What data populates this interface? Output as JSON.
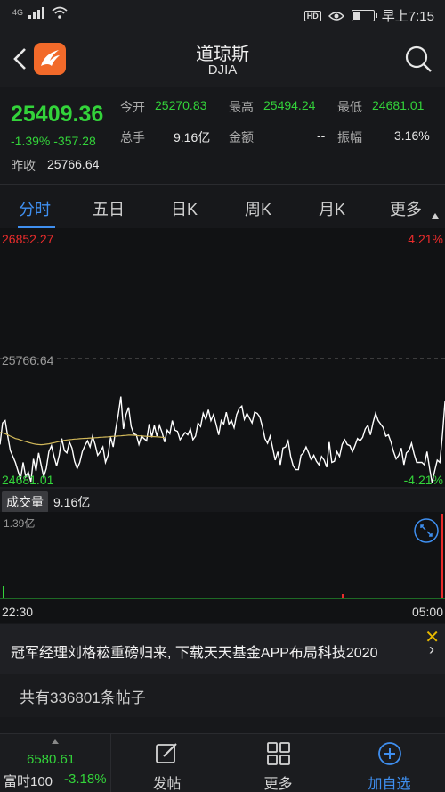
{
  "status_bar": {
    "network": "4G",
    "indicator": "HD",
    "time": "早上7:15"
  },
  "header": {
    "title": "道琼斯",
    "subtitle": "DJIA"
  },
  "quote": {
    "price": "25409.36",
    "change": "-1.39%  -357.28",
    "prev_close_label": "昨收",
    "prev_close": "25766.64",
    "open_label": "今开",
    "open": "25270.83",
    "high_label": "最高",
    "high": "25494.24",
    "low_label": "最低",
    "low": "24681.01",
    "volume_label": "总手",
    "volume": "9.16亿",
    "amount_label": "金额",
    "amount": "--",
    "amplitude_label": "振幅",
    "amplitude": "3.16%"
  },
  "tabs": [
    "分时",
    "五日",
    "日K",
    "周K",
    "月K",
    "更多"
  ],
  "active_tab": "分时",
  "chart_data": {
    "type": "line",
    "y_max_label": "26852.27",
    "y_mid_label": "25766.64",
    "y_min_label": "24681.01",
    "pct_max_label": "4.21%",
    "pct_min_label": "-4.21%",
    "ylim": [
      24681.01,
      26852.27
    ],
    "reference": 25766.64,
    "x_start": "22:30",
    "x_end": "05:00",
    "series": [
      {
        "values": [
          25050,
          25230,
          25250,
          25120,
          25000,
          24950,
          24900,
          24830,
          24760,
          24900,
          24780,
          24820,
          24740,
          24930,
          24830,
          24980,
          24880,
          24780,
          24850,
          24990,
          25040,
          24950,
          24870,
          24960,
          25100,
          25000,
          24980,
          25070,
          25020,
          24910,
          24850,
          24900,
          24990,
          25040,
          25080,
          25030,
          25120,
          25050,
          24960,
          24990,
          25030,
          24900,
          24960,
          25110,
          25030,
          25180,
          25300,
          25450,
          25180,
          25300,
          25360,
          25200,
          25140,
          25130,
          25050,
          25120,
          25100,
          25080,
          25220,
          25110,
          25210,
          25120,
          25210,
          25150,
          25070,
          25170,
          25140,
          25250,
          25170,
          25160,
          25090,
          25120,
          25150,
          25130,
          25180,
          25090,
          25120,
          25230,
          25200,
          25310,
          25260,
          25340,
          25250,
          25300,
          25220,
          25130,
          25250,
          25220,
          25320,
          25220,
          25250,
          25190,
          25300,
          25350,
          25370,
          25260,
          25310,
          25270,
          25230,
          25320,
          25310,
          25280,
          25200,
          25100,
          25060,
          25120,
          25020,
          24920,
          24990,
          24880,
          25020,
          25030,
          25080,
          24950,
          24870,
          24840,
          24840,
          24960,
          24980,
          25030,
          24980,
          24920,
          24960,
          24910,
          24880,
          24950,
          24920,
          24860,
          25070,
          24900,
          24910,
          24990,
          24950,
          25050,
          25090,
          25050,
          25040,
          24990,
          25040,
          25100,
          25080,
          25110,
          25180,
          25210,
          25130,
          25230,
          25310,
          25250,
          25220,
          25190,
          25120,
          25130,
          25070,
          24990,
          24930,
          24960,
          25020,
          24880,
          24980,
          25000,
          25060,
          24970,
          24900,
          24900,
          24900,
          24880,
          24990,
          24850,
          24730,
          24830,
          24920,
          24900,
          25130,
          25409.36
        ],
        "color": "#ffffff"
      },
      {
        "values": [
          25150,
          25147,
          25140,
          25130,
          25120,
          25110,
          25100,
          25095,
          25088,
          25080,
          25074,
          25068,
          25062,
          25056,
          25052,
          25050,
          25048,
          25050,
          25053,
          25056,
          25060,
          25065,
          25070,
          25075,
          25080,
          25085,
          25088,
          25090,
          25092,
          25095,
          25096,
          25098,
          25100,
          25101,
          25102,
          25104,
          25104,
          25106,
          25108,
          25110,
          25111,
          25112,
          25114,
          25116,
          25118,
          25119,
          25121,
          25122,
          25124,
          25126,
          25128,
          25128,
          25127,
          25125,
          25123,
          25122,
          25120,
          25118,
          25117,
          25116,
          25115,
          25114,
          25112,
          25110,
          25107
        ],
        "color": "#d2b95a"
      }
    ]
  },
  "volume": {
    "label": "成交量",
    "value": "9.16亿",
    "max_label": "1.39亿",
    "time_start": "22:30",
    "time_end": "05:00"
  },
  "ad": {
    "text": "冠军经理刘格菘重磅归来, 下载天天基金APP布局科技2020"
  },
  "posts": {
    "text": "共有336801条帖子"
  },
  "bottom_nav": {
    "mini_value": "6580.61",
    "mini_name": "富时100",
    "mini_change": "-3.18%",
    "items": [
      "发帖",
      "更多",
      "加自选"
    ]
  },
  "colors": {
    "up": "#ea2c2c",
    "down": "#33d33a",
    "accent": "#3f8ff0",
    "avg_line": "#d2b95a"
  }
}
